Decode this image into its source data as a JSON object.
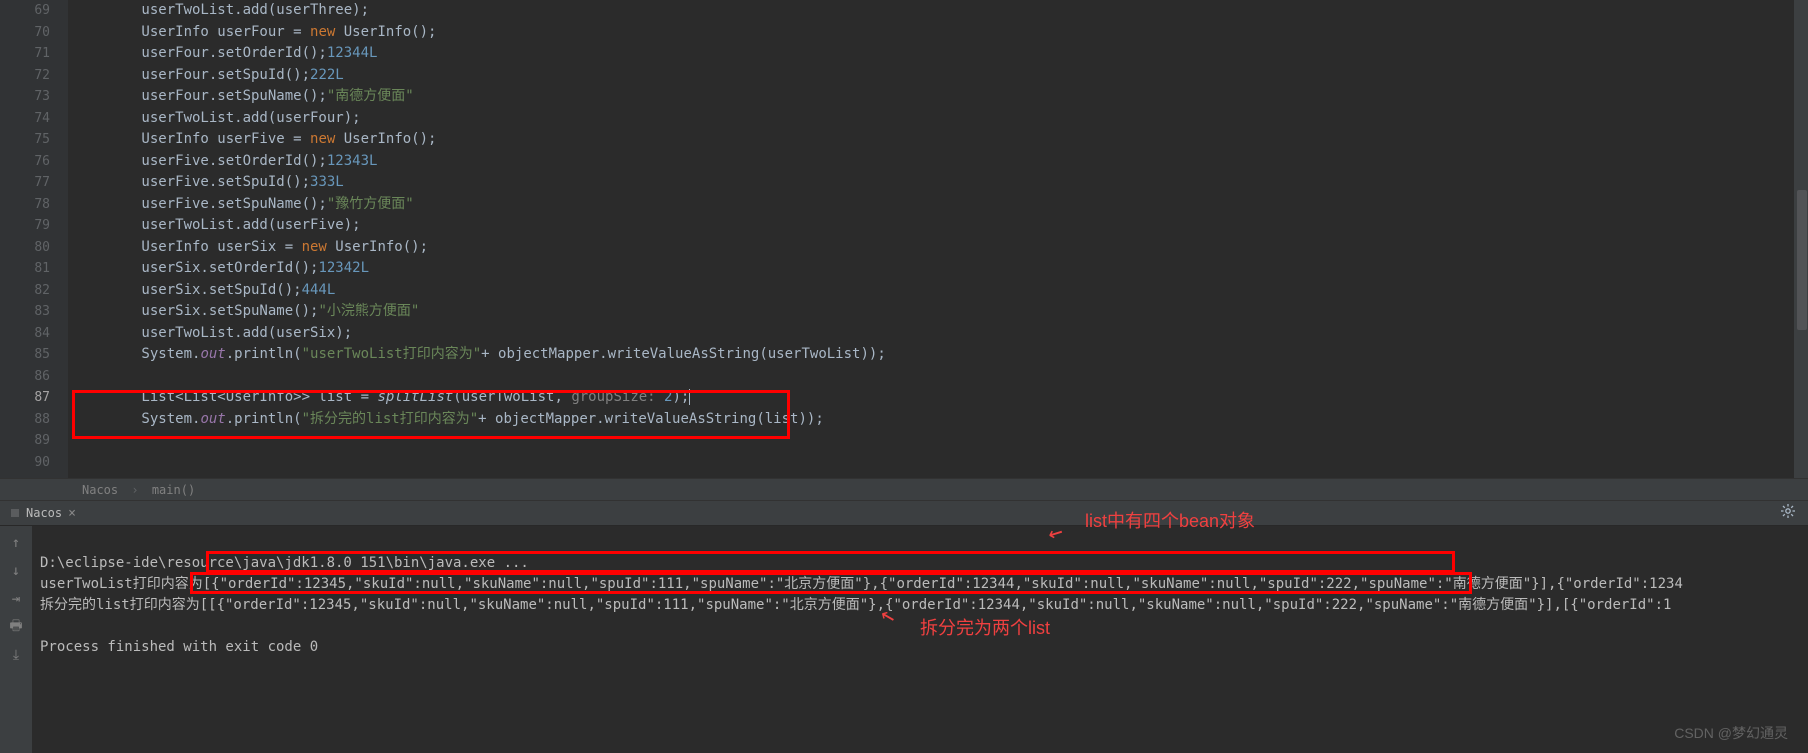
{
  "gutter": {
    "start": 69,
    "end": 90,
    "current": 87
  },
  "code": {
    "l69": {
      "prefix": "        ",
      "a": "userTwoList.add(userThree);"
    },
    "l70": {
      "prefix": "        ",
      "a": "UserInfo userFour = ",
      "kw": "new",
      "b": " UserInfo();"
    },
    "l71": {
      "prefix": "        ",
      "a": "userFour.setOrderId(",
      "n": "12344L",
      "b": ");"
    },
    "l72": {
      "prefix": "        ",
      "a": "userFour.setSpuId(",
      "n": "222L",
      "b": ");"
    },
    "l73": {
      "prefix": "        ",
      "a": "userFour.setSpuName(",
      "s": "\"南德方便面\"",
      "b": ");"
    },
    "l74": {
      "prefix": "        ",
      "a": "userTwoList.add(userFour);"
    },
    "l75": {
      "prefix": "        ",
      "a": "UserInfo userFive = ",
      "kw": "new",
      "b": " UserInfo();"
    },
    "l76": {
      "prefix": "        ",
      "a": "userFive.setOrderId(",
      "n": "12343L",
      "b": ");"
    },
    "l77": {
      "prefix": "        ",
      "a": "userFive.setSpuId(",
      "n": "333L",
      "b": ");"
    },
    "l78": {
      "prefix": "        ",
      "a": "userFive.setSpuName(",
      "s": "\"豫竹方便面\"",
      "b": ");"
    },
    "l79": {
      "prefix": "        ",
      "a": "userTwoList.add(userFive);"
    },
    "l80": {
      "prefix": "        ",
      "a": "UserInfo userSix = ",
      "kw": "new",
      "b": " UserInfo();"
    },
    "l81": {
      "prefix": "        ",
      "a": "userSix.setOrderId(",
      "n": "12342L",
      "b": ");"
    },
    "l82": {
      "prefix": "        ",
      "a": "userSix.setSpuId(",
      "n": "444L",
      "b": ");"
    },
    "l83": {
      "prefix": "        ",
      "a": "userSix.setSpuName(",
      "s": "\"小浣熊方便面\"",
      "b": ");"
    },
    "l84": {
      "prefix": "        ",
      "a": "userTwoList.add(userSix);"
    },
    "l85": {
      "prefix": "        ",
      "a": "System.",
      "f": "out",
      "b": ".println(",
      "s": "\"userTwoList打印内容为\"",
      "c": "+ objectMapper.writeValueAsString(userTwoList));"
    },
    "l86": "",
    "l87": {
      "prefix": "        ",
      "a": "List<List<UserInfo>> list = ",
      "m": "splitList",
      "b": "(userTwoList, ",
      "p": "groupSize: ",
      "n": "2",
      "c": ");"
    },
    "l88": {
      "prefix": "        ",
      "a": "System.",
      "f": "out",
      "b": ".println(",
      "s": "\"拆分完的list打印内容为\"",
      "c": "+ objectMapper.writeValueAsString(list));"
    },
    "l89": "",
    "l90": ""
  },
  "breadcrumb": {
    "a": "Nacos",
    "b": "main()"
  },
  "tab": {
    "name": "Nacos"
  },
  "console": {
    "cmd": "D:\\eclipse-ide\\resource\\java\\jdk1.8.0 151\\bin\\java.exe ...",
    "line1_prefix": "userTwoList打印内容为",
    "line1_json": "[{\"orderId\":12345,\"skuId\":null,\"skuName\":null,\"spuId\":111,\"spuName\":\"北京方便面\"},{\"orderId\":12344,\"skuId\":null,\"skuName\":null,\"spuId\":222,\"spuName\":\"南德方便面\"}],{\"orderId\":1234",
    "line2_prefix": "拆分完的list打印内容为",
    "line2_json": "[[{\"orderId\":12345,\"skuId\":null,\"skuName\":null,\"spuId\":111,\"spuName\":\"北京方便面\"},{\"orderId\":12344,\"skuId\":null,\"skuName\":null,\"spuId\":222,\"spuName\":\"南德方便面\"}],[{\"orderId\":1",
    "exit": "Process finished with exit code 0"
  },
  "annotations": {
    "a1": "list中有四个bean对象",
    "a2": "拆分完为两个list"
  },
  "watermark": "CSDN @梦幻通灵"
}
